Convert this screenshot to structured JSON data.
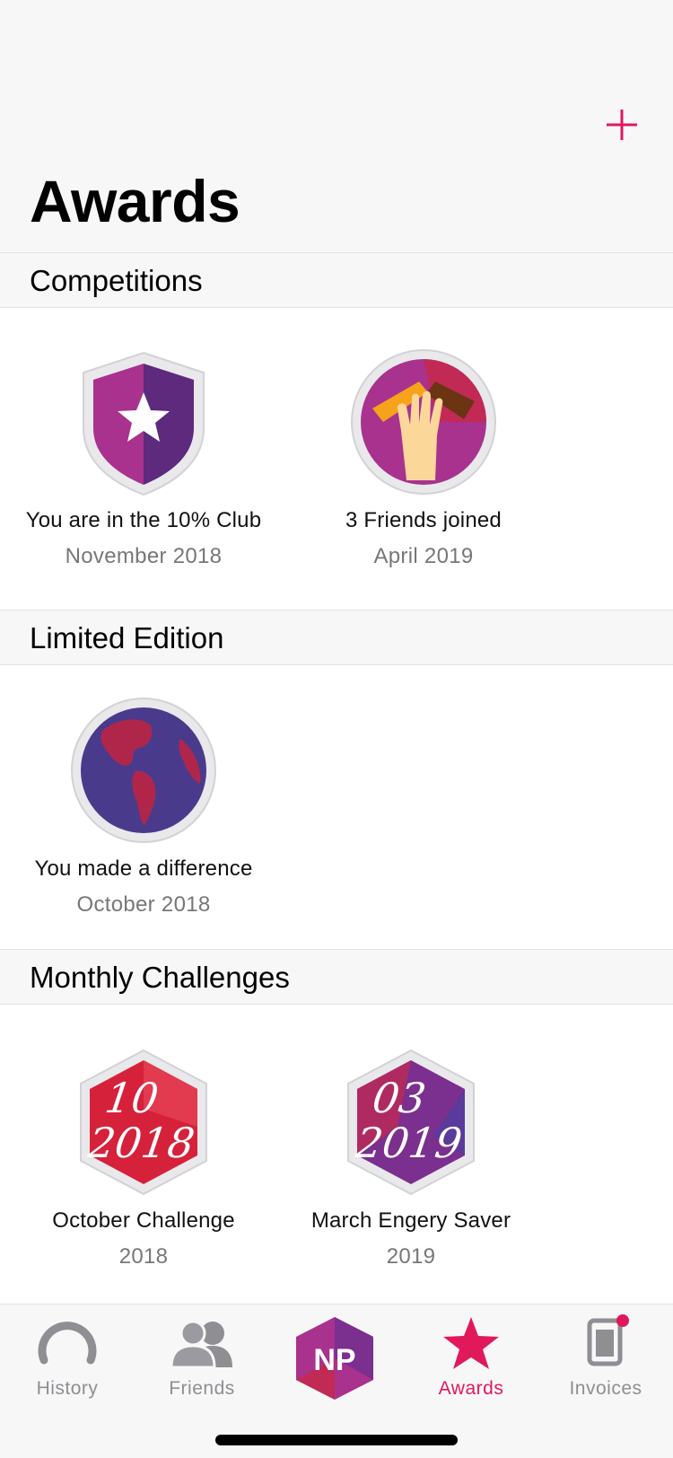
{
  "header": {
    "title": "Awards",
    "add_icon": "plus-icon"
  },
  "colors": {
    "accent": "#e0195a",
    "section_bg": "#f7f7f8",
    "muted": "#777777"
  },
  "sections": [
    {
      "title": "Competitions",
      "awards": [
        {
          "name": "You are in the 10% Club",
          "date": "November 2018",
          "icon": "shield-star-badge"
        },
        {
          "name": "3 Friends joined",
          "date": "April 2019",
          "icon": "hands-badge"
        }
      ]
    },
    {
      "title": "Limited Edition",
      "awards": [
        {
          "name": "You made a difference",
          "date": "October 2018",
          "icon": "globe-badge"
        }
      ]
    },
    {
      "title": "Monthly Challenges",
      "awards": [
        {
          "name": "October Challenge",
          "date": "2018",
          "icon": "hexagon-badge",
          "badge_text_top": "10",
          "badge_text_bottom": "2018"
        },
        {
          "name": "March Engery Saver",
          "date": "2019",
          "icon": "hexagon-badge",
          "badge_text_top": "03",
          "badge_text_bottom": "2019"
        }
      ]
    }
  ],
  "tabbar": {
    "tabs": [
      {
        "label": "History",
        "icon": "history-icon",
        "active": false
      },
      {
        "label": "Friends",
        "icon": "friends-icon",
        "active": false
      },
      {
        "label": "",
        "icon": "np-logo-icon",
        "active": false,
        "logo_text": "NP"
      },
      {
        "label": "Awards",
        "icon": "star-icon",
        "active": true
      },
      {
        "label": "Invoices",
        "icon": "invoice-icon",
        "active": false,
        "badge": true
      }
    ]
  }
}
